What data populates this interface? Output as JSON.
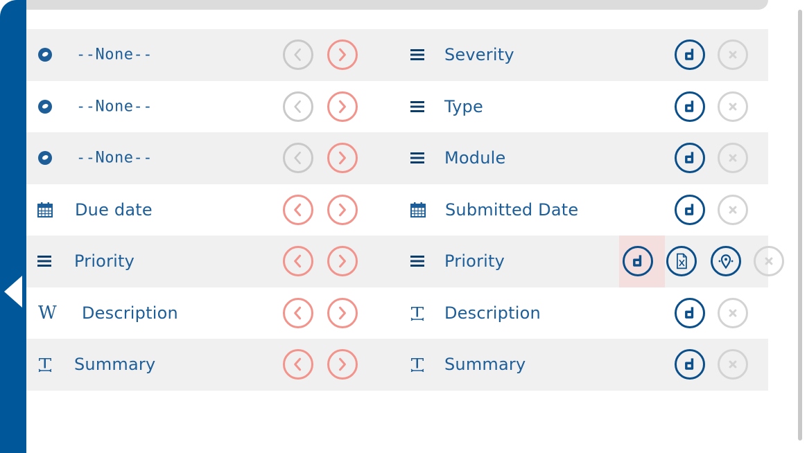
{
  "rows": [
    {
      "left_label": "--None--",
      "left_icon": "circle-dot-icon",
      "right_label": "Severity",
      "right_icon": "list-icon"
    },
    {
      "left_label": "--None--",
      "left_icon": "circle-dot-icon",
      "right_label": "Type",
      "right_icon": "list-icon"
    },
    {
      "left_label": "--None--",
      "left_icon": "circle-dot-icon",
      "right_label": "Module",
      "right_icon": "list-icon"
    },
    {
      "left_label": "Due date",
      "left_icon": "calendar-icon",
      "right_label": "Submitted Date",
      "right_icon": "calendar-icon"
    },
    {
      "left_label": "Priority",
      "left_icon": "list-icon",
      "right_label": "Priority",
      "right_icon": "list-icon"
    },
    {
      "left_label": "Description",
      "left_icon": "wiki-w-icon",
      "right_label": "Description",
      "right_icon": "text-t-icon"
    },
    {
      "left_label": "Summary",
      "left_icon": "text-t-icon",
      "right_label": "Summary",
      "right_icon": "text-t-icon"
    }
  ],
  "glyphs": {
    "wiki_w": "W"
  },
  "colors": {
    "sidebar": "#00579a",
    "label": "#1d5e99",
    "arrow_active": "#f2938c",
    "arrow_disabled": "#c9c9c9",
    "action_blue": "#0b4f8a",
    "remove_grey": "#d3d3d3"
  }
}
